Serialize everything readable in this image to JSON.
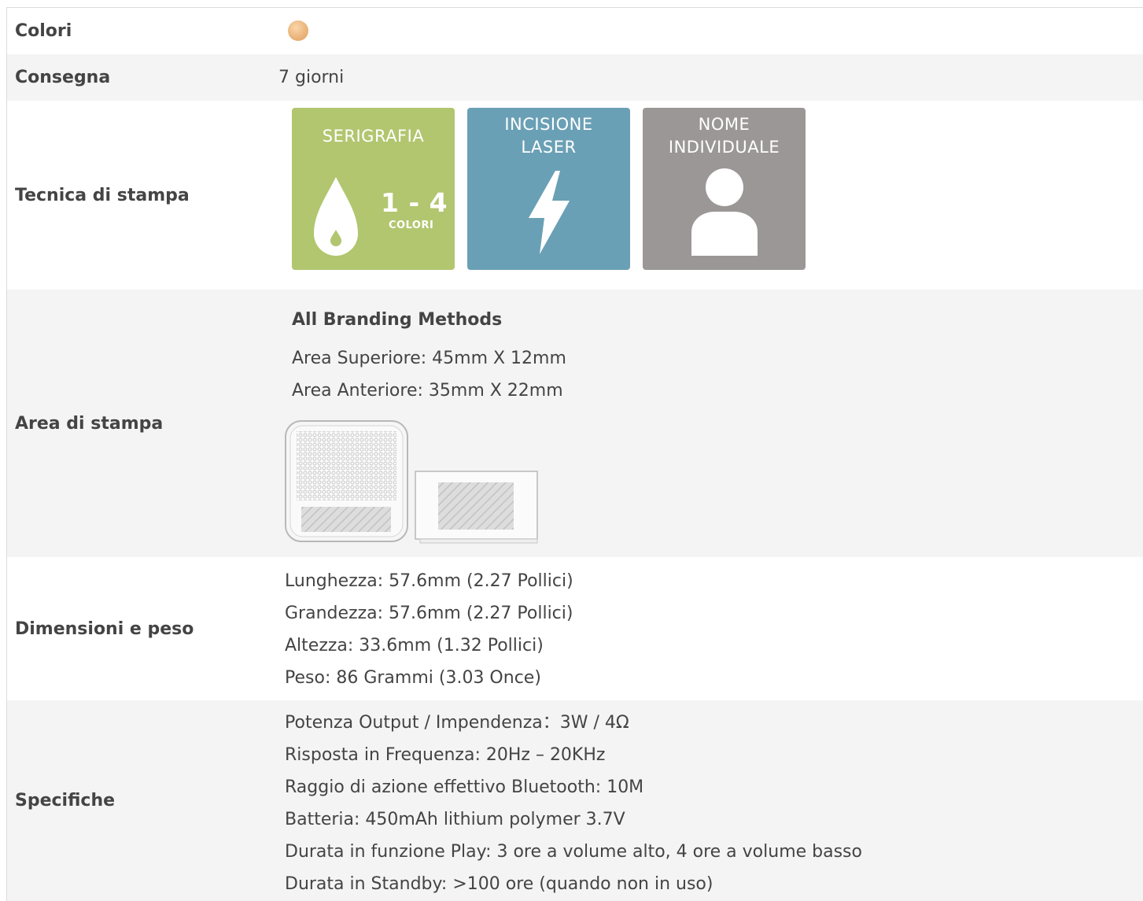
{
  "rows": {
    "colori": {
      "label": "Colori",
      "swatch_color": "#efc08b"
    },
    "consegna": {
      "label": "Consegna",
      "value": "7 giorni"
    },
    "tecnica": {
      "label": "Tecnica di stampa",
      "tiles": [
        {
          "title_line1": "SERIGRAFIA",
          "range": "1 - 4",
          "range_sub": "COLORI",
          "color": "#b1c66f",
          "icon": "ink-drop-icon"
        },
        {
          "title_line1": "INCISIONE",
          "title_line2": "LASER",
          "color": "#6aa0b5",
          "icon": "lightning-bolt-icon"
        },
        {
          "title_line1": "NOME",
          "title_line2": "INDIVIDUALE",
          "color": "#9b9796",
          "icon": "person-icon"
        }
      ]
    },
    "area": {
      "label": "Area di stampa",
      "heading": "All Branding Methods",
      "lines": [
        "Area Superiore: 45mm X 12mm",
        "Area Anteriore: 35mm X 22mm"
      ]
    },
    "dimensioni": {
      "label": "Dimensioni e peso",
      "lines": [
        "Lunghezza: 57.6mm (2.27 Pollici)",
        "Grandezza: 57.6mm (2.27 Pollici)",
        "Altezza: 33.6mm (1.32 Pollici)",
        "Peso: 86 Grammi (3.03 Once)"
      ]
    },
    "specifiche": {
      "label": "Specifiche",
      "lines": [
        "Potenza Output / Impendenza：3W / 4Ω",
        "Risposta in Frequenza: 20Hz – 20KHz",
        "Raggio di azione effettivo Bluetooth: 10M",
        "Batteria: 450mAh lithium polymer 3.7V",
        "Durata in funzione Play: 3 ore a volume alto, 4 ore a volume basso",
        "Durata in Standby: >100 ore (quando non in uso)"
      ]
    }
  }
}
